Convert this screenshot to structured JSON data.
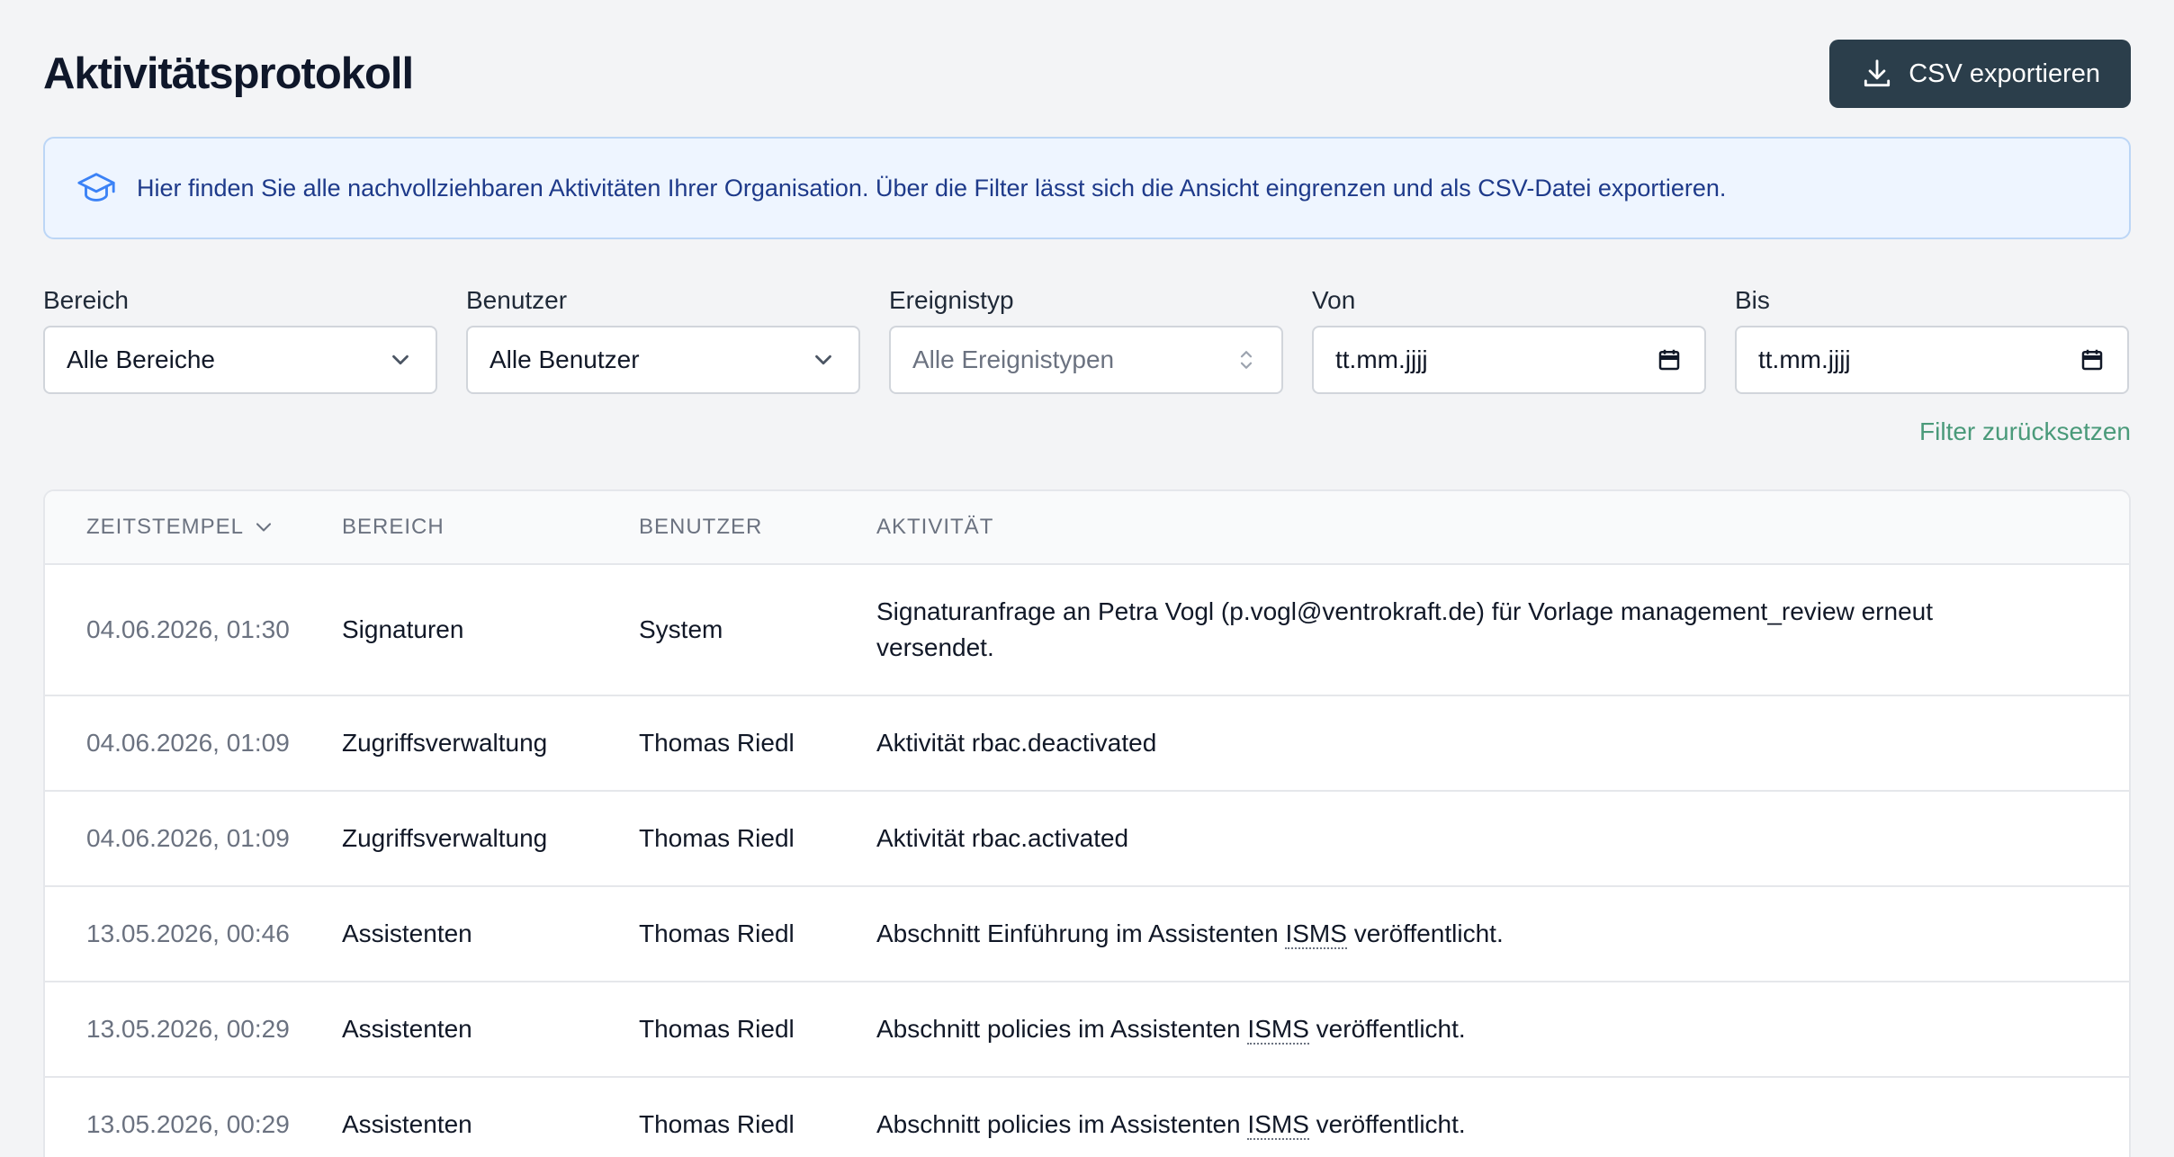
{
  "header": {
    "title": "Aktivitätsprotokoll",
    "export_label": "CSV exportieren"
  },
  "info": {
    "text": "Hier finden Sie alle nachvollziehbaren Aktivitäten Ihrer Organisation. Über die Filter lässt sich die Ansicht eingrenzen und als CSV-Datei exportieren."
  },
  "filters": {
    "bereich": {
      "label": "Bereich",
      "value": "Alle Bereiche"
    },
    "benutzer": {
      "label": "Benutzer",
      "value": "Alle Benutzer"
    },
    "ereignistyp": {
      "label": "Ereignistyp",
      "value": "Alle Ereignistypen"
    },
    "von": {
      "label": "Von",
      "value": "tt.mm.jjjj"
    },
    "bis": {
      "label": "Bis",
      "value": "tt.mm.jjjj"
    },
    "reset_label": "Filter zurücksetzen"
  },
  "table": {
    "headers": {
      "timestamp": "ZEITSTEMPEL",
      "bereich": "BEREICH",
      "benutzer": "BENUTZER",
      "aktivitaet": "AKTIVITÄT"
    },
    "rows": [
      {
        "timestamp": "04.06.2026, 01:30",
        "bereich": "Signaturen",
        "benutzer": "System",
        "aktivitaet": "Signaturanfrage an Petra Vogl (p.vogl@ventrokraft.de) für Vorlage management_review erneut versendet."
      },
      {
        "timestamp": "04.06.2026, 01:09",
        "bereich": "Zugriffsverwaltung",
        "benutzer": "Thomas Riedl",
        "aktivitaet": "Aktivität rbac.deactivated"
      },
      {
        "timestamp": "04.06.2026, 01:09",
        "bereich": "Zugriffsverwaltung",
        "benutzer": "Thomas Riedl",
        "aktivitaet": "Aktivität rbac.activated"
      },
      {
        "timestamp": "13.05.2026, 00:46",
        "bereich": "Assistenten",
        "benutzer": "Thomas Riedl",
        "aktivitaet_pre": "Abschnitt Einführung im Assistenten ",
        "aktivitaet_abbr": "ISMS",
        "aktivitaet_post": " veröffentlicht."
      },
      {
        "timestamp": "13.05.2026, 00:29",
        "bereich": "Assistenten",
        "benutzer": "Thomas Riedl",
        "aktivitaet_pre": "Abschnitt policies im Assistenten ",
        "aktivitaet_abbr": "ISMS",
        "aktivitaet_post": " veröffentlicht."
      },
      {
        "timestamp": "13.05.2026, 00:29",
        "bereich": "Assistenten",
        "benutzer": "Thomas Riedl",
        "aktivitaet_pre": "Abschnitt policies im Assistenten ",
        "aktivitaet_abbr": "ISMS",
        "aktivitaet_post": " veröffentlicht."
      }
    ]
  },
  "icons": {
    "export": "download-icon",
    "info": "graduation-cap-icon",
    "select": "chevron-down-icon",
    "select_updown": "chevron-up-down-icon",
    "date": "calendar-icon",
    "sort": "chevron-down-icon"
  },
  "colors": {
    "export_button": "#2b3e4b",
    "info_bg": "#eef5ff",
    "info_text": "#1e3a8a",
    "reset_link": "#4a9a7a"
  }
}
